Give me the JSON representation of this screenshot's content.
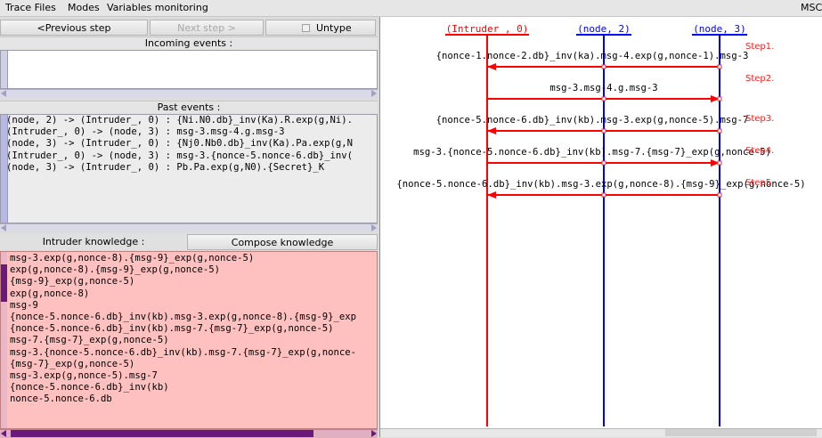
{
  "menu": {
    "trace_files": "Trace Files",
    "modes": "Modes",
    "variables_monitoring": "Variables monitoring",
    "right_label": "MSC"
  },
  "controls": {
    "prev_step": "<Previous step",
    "next_step": "Next step >",
    "untype": "Untype"
  },
  "incoming": {
    "header": "Incoming events :",
    "lines": []
  },
  "past": {
    "header": "Past events :",
    "lines": [
      "(node, 2) -> (Intruder_, 0) : {Ni.N0.db}_inv(Ka).R.exp(g,Ni).",
      "(Intruder_, 0) -> (node, 3) : msg-3.msg-4.g.msg-3",
      "(node, 3) -> (Intruder_, 0) : {Nj0.Nb0.db}_inv(Ka).Pa.exp(g,N",
      "(Intruder_, 0) -> (node, 3) : msg-3.{nonce-5.nonce-6.db}_inv(",
      "(node, 3) -> (Intruder_, 0) : Pb.Pa.exp(g,N0).{Secret}_K"
    ]
  },
  "knowledge": {
    "tab_intruder": "Intruder knowledge :",
    "tab_compose": "Compose knowledge",
    "lines": [
      "msg-3.exp(g,nonce-8).{msg-9}_exp(g,nonce-5)",
      "exp(g,nonce-8).{msg-9}_exp(g,nonce-5)",
      "{msg-9}_exp(g,nonce-5)",
      "exp(g,nonce-8)",
      "msg-9",
      "{nonce-5.nonce-6.db}_inv(kb).msg-3.exp(g,nonce-8).{msg-9}_exp",
      "{nonce-5.nonce-6.db}_inv(kb).msg-7.{msg-7}_exp(g,nonce-5)",
      "msg-7.{msg-7}_exp(g,nonce-5)",
      "msg-3.{nonce-5.nonce-6.db}_inv(kb).msg-7.{msg-7}_exp(g,nonce-",
      "{msg-7}_exp(g,nonce-5)",
      "msg-3.exp(g,nonce-5).msg-7",
      "{nonce-5.nonce-6.db}_inv(kb)",
      "nonce-5.nonce-6.db"
    ],
    "bg_color": "#ffc0c0"
  },
  "msc": {
    "lifelines": [
      {
        "label": "(Intruder_, 0)",
        "color": "#ff0000"
      },
      {
        "label": "(node, 2)",
        "color": "#0000ff"
      },
      {
        "label": "(node, 3)",
        "color": "#0000ff"
      }
    ],
    "steps": [
      {
        "label": "Step1.",
        "message": "{nonce-1.nonce-2.db}_inv(ka).msg-4.exp(g,nonce-1).msg-3",
        "from": 2,
        "to": 0
      },
      {
        "label": "Step2.",
        "message": "msg-3.msg-4.g.msg-3",
        "from": 0,
        "to": 2
      },
      {
        "label": "Step3.",
        "message": "{nonce-5.nonce-6.db}_inv(kb).msg-3.exp(g,nonce-5).msg-7",
        "from": 2,
        "to": 0
      },
      {
        "label": "Step4.",
        "message": "msg-3.{nonce-5.nonce-6.db}_inv(kb).msg-7.{msg-7}_exp(g,nonce-5)",
        "from": 0,
        "to": 2
      },
      {
        "label": "Step5.",
        "message": "{nonce-5.nonce-6.db}_inv(kb).msg-3.exp(g,nonce-8).{msg-9}_exp(g,nonce-5)",
        "from": 2,
        "to": 0
      }
    ],
    "arrow_color": "#ff0000",
    "step_label_color": "#ff2020"
  }
}
